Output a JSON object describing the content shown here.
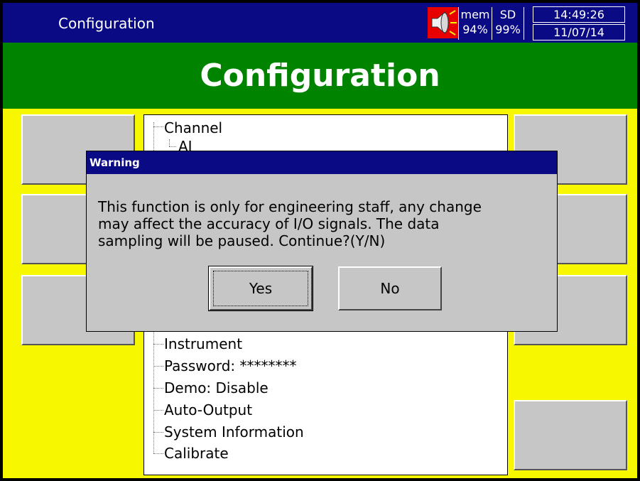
{
  "header": {
    "app_title": "Configuration",
    "mem_label": "mem",
    "mem_value": "94%",
    "sd_label": "SD",
    "sd_value": "99%",
    "time": "14:49:26",
    "date": "11/07/14",
    "speaker_icon": "speaker-icon"
  },
  "banner": {
    "title": "Configuration"
  },
  "tree": {
    "items": [
      "Channel",
      "AI",
      "Instrument",
      "Password: ********",
      "Demo: Disable",
      "Auto-Output",
      "System Information",
      "Calibrate"
    ]
  },
  "dialog": {
    "title": "Warning",
    "message_lines": [
      "This function is only for engineering staff, any change",
      "may affect the accuracy of I/O signals. The data",
      "sampling will be paused. Continue?(Y/N)"
    ],
    "yes_label": "Yes",
    "no_label": "No"
  },
  "colors": {
    "background": "#f7f700",
    "title_bar": "#0a0a84",
    "banner": "#008400",
    "speaker": "#e80000",
    "button_face": "#c6c6c6"
  }
}
